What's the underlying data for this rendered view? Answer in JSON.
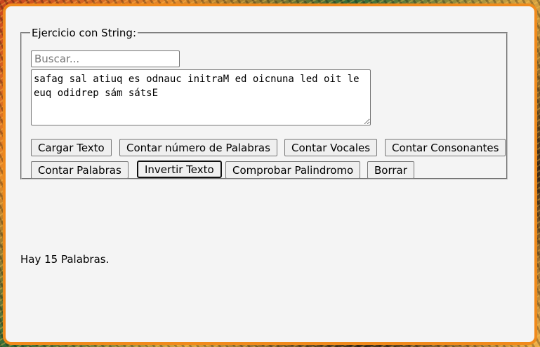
{
  "form": {
    "legend": "Ejercicio con String:",
    "search_placeholder": "Buscar...",
    "search_value": "",
    "textarea_value": "safag sal atiuq es odnauc initraM ed oicnuna led oit le euq odidrep sám sátsE"
  },
  "buttons": {
    "cargar_texto": "Cargar Texto",
    "contar_numero_palabras": "Contar número de Palabras",
    "contar_vocales": "Contar Vocales",
    "contar_consonantes": "Contar Consonantes",
    "contar_palabras": "Contar Palabras",
    "invertir_texto": "Invertir Texto",
    "comprobar_palindromo": "Comprobar Palindromo",
    "borrar": "Borrar"
  },
  "result": {
    "text": "Hay 15 Palabras."
  },
  "colors": {
    "frame_border": "#f08a1c",
    "panel_background": "#f4f4f4"
  }
}
